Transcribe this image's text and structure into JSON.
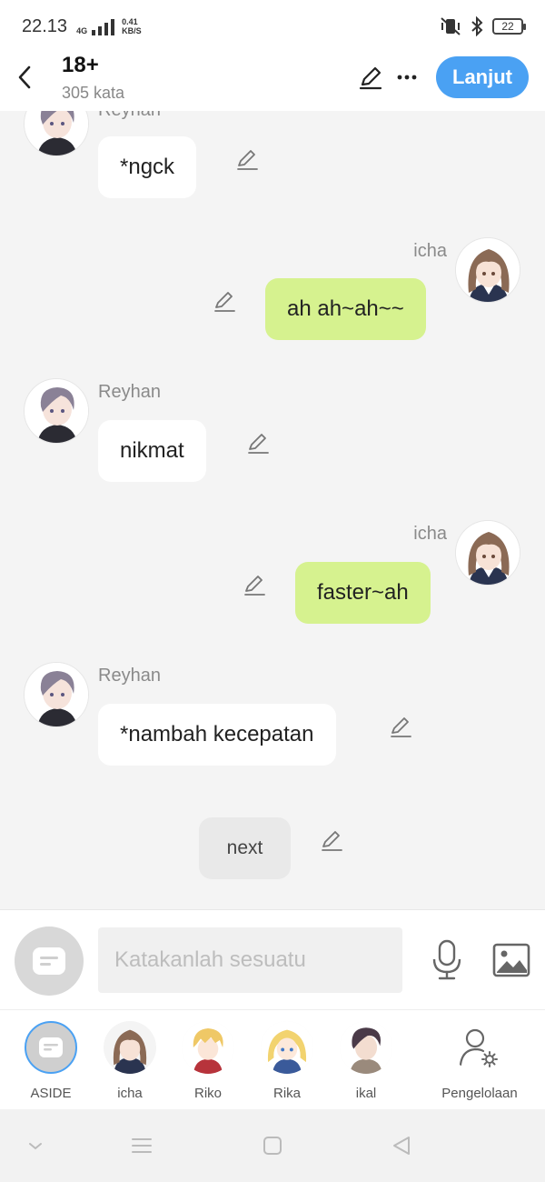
{
  "status": {
    "time": "22.13",
    "network": "4G",
    "speed_value": "0.41",
    "speed_unit": "KB/S",
    "battery": "22"
  },
  "header": {
    "title": "18+",
    "subtitle": "305 kata",
    "next_label": "Lanjut",
    "accent_color": "#4aa1f3"
  },
  "messages": [
    {
      "sender": "Reyhan",
      "text": "*ngck",
      "side": "left"
    },
    {
      "sender": "icha",
      "text": "ah ah~ah~~",
      "side": "right"
    },
    {
      "sender": "Reyhan",
      "text": "nikmat",
      "side": "left"
    },
    {
      "sender": "icha",
      "text": "faster~ah",
      "side": "right"
    },
    {
      "sender": "Reyhan",
      "text": "*nambah kecepatan",
      "side": "left"
    }
  ],
  "next_button": "next",
  "input": {
    "placeholder": "Katakanlah sesuatu"
  },
  "characters": [
    {
      "label": "ASIDE"
    },
    {
      "label": "icha"
    },
    {
      "label": "Riko"
    },
    {
      "label": "Rika"
    },
    {
      "label": "ikal"
    }
  ],
  "manage_label": "Pengelolaan",
  "colors": {
    "bubble_right": "#d6f28f",
    "bubble_left": "#ffffff",
    "background": "#f4f4f4"
  }
}
